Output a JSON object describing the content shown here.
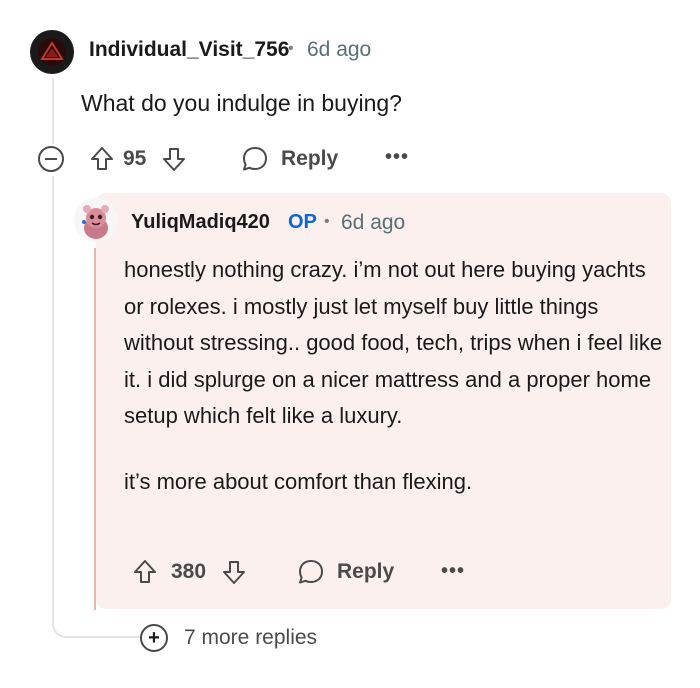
{
  "top_comment": {
    "author": "Individual_Visit_756",
    "separator": "•",
    "time": "6d ago",
    "body": "What do you indulge in buying?",
    "actions": {
      "collapse": "−",
      "score": "95",
      "reply_label": "Reply",
      "more": "•••"
    }
  },
  "reply_comment": {
    "author": "YuliqMadiq420",
    "badge": "OP",
    "separator": "•",
    "time": "6d ago",
    "paragraphs": [
      "honestly nothing crazy. i’m not out here buying yachts or rolexes. i mostly just let myself buy little things without stressing.. good food, tech, trips when i feel like it. i did splurge on a nicer mattress and a proper home setup which felt like a luxury.",
      "it’s more about comfort than flexing."
    ],
    "actions": {
      "score": "380",
      "reply_label": "Reply",
      "more": "•••"
    }
  },
  "more_replies": {
    "plus": "+",
    "label": "7 more replies"
  },
  "colors": {
    "reply_background": "#fbf0ee",
    "op_badge": "#0a66d2",
    "reply_thread": "#e4b9a7",
    "text": "#1a1a1b",
    "muted": "#576f76"
  }
}
